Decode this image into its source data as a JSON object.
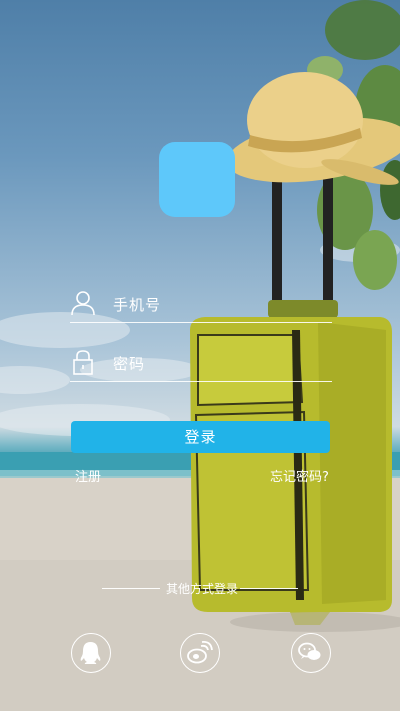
{
  "login": {
    "phone_label": "手机号",
    "password_label": "密码",
    "button_label": "登录",
    "register_link": "注册",
    "forgot_link": "忘记密码?"
  },
  "other_login": {
    "label": "其他方式登录",
    "providers": [
      {
        "icon": "qq-icon"
      },
      {
        "icon": "weibo-icon"
      },
      {
        "icon": "wechat-icon"
      }
    ]
  },
  "colors": {
    "logo": "#5ec8fa",
    "button": "#21b3e8",
    "text": "#ffffff",
    "suitcase": "#b9bd2e"
  },
  "icons": {
    "phone_field": "user-icon",
    "password_field": "lock-icon"
  }
}
